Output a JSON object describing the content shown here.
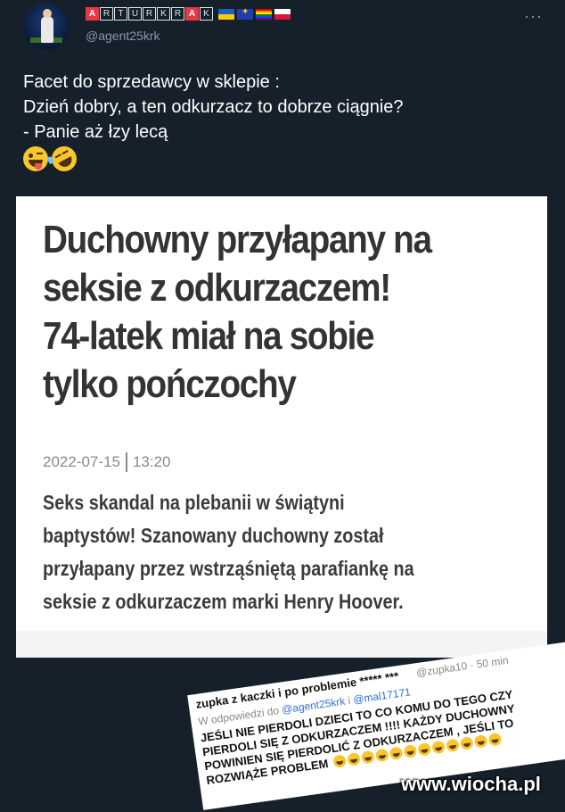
{
  "user": {
    "display_name_letters": [
      "A",
      "R",
      "T",
      "U",
      "R",
      "K",
      "R",
      "A",
      "K"
    ],
    "handle": "@agent25krk",
    "flags": [
      "ukraine-flag",
      "eu-flag",
      "rainbow-flag",
      "poland-flag"
    ]
  },
  "more_label": "···",
  "tweet": {
    "lines": [
      "Facet do sprzedawcy w sklepie :",
      "Dzień dobry, a ten odkurzacz to dobrze ciągnie?",
      "- Panie aż łzy lecą"
    ],
    "emojis": [
      "zany-face-emoji",
      "rolling-on-floor-laughing-emoji"
    ]
  },
  "article": {
    "headline": [
      "Duchowny przyłapany na",
      "seksie z odkurzaczem!",
      "74-latek miał na sobie",
      "tylko pończochy"
    ],
    "date": "2022-07-15",
    "time": "13:20",
    "lead": [
      "Seks skandal na plebanii w świątyni",
      "baptystów! Szanowany duchowny został",
      "przyłapany przez wstrząśniętą parafiankę na",
      "seksie z odkurzaczem marki Henry Hoover."
    ]
  },
  "comment": {
    "author": "zupka z kaczki i po problemie ***** ***",
    "handle_time": "@zupka10 · 50 min",
    "reply_prefix": "W odpowiedzi do",
    "reply_mention_1": "@agent25krk",
    "reply_and": "i",
    "reply_mention_2": "@mal17171",
    "body": [
      "JEŚLI NIE PIERDOLI DZIECI TO CO KOMU DO TEGO CZY",
      "PIERDOLI SIĘ Z ODKURZACZEM !!!! KAŻDY DUCHOWNY",
      "POWINIEN SIĘ PIERDOLIĆ Z ODKURZACZEM , JEŚLI TO",
      "ROZWIĄŻE PROBLEM"
    ],
    "laugh_count": 12
  },
  "watermark": "www.wiocha.pl"
}
